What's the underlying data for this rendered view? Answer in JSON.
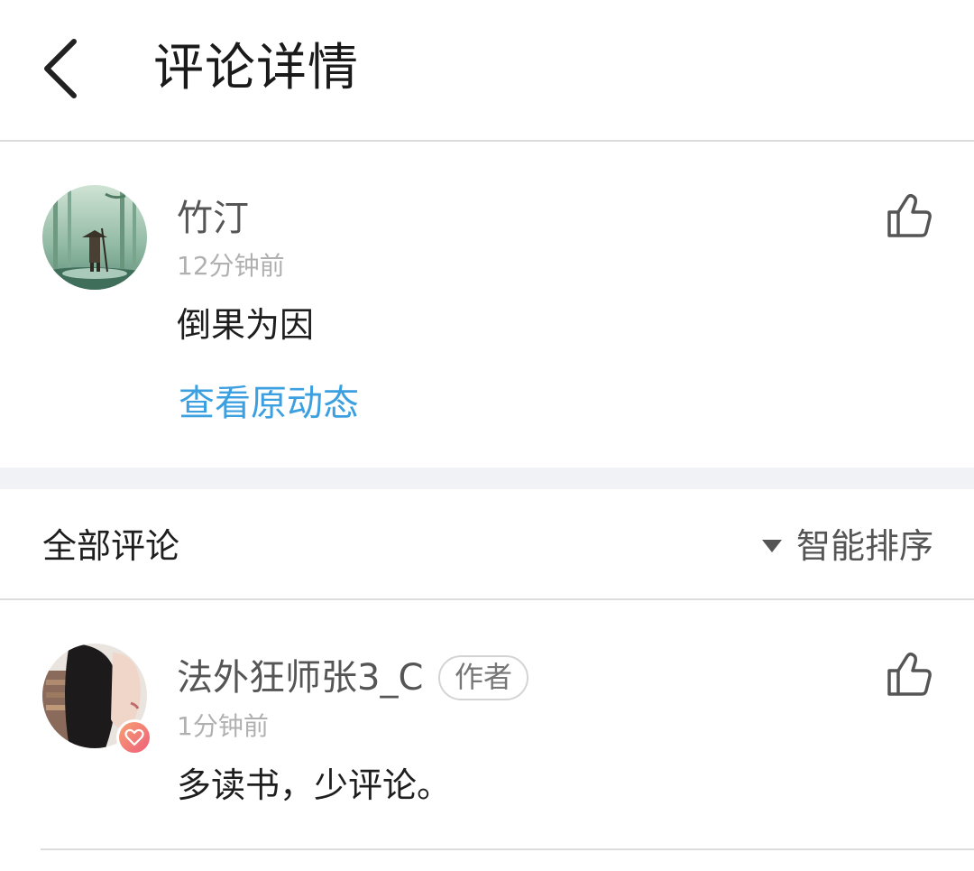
{
  "header": {
    "title": "评论详情"
  },
  "main_comment": {
    "author": "竹汀",
    "time": "12分钟前",
    "text": "倒果为因",
    "view_original": "查看原动态"
  },
  "comments_section": {
    "title": "全部评论",
    "sort_label": "智能排序"
  },
  "replies": [
    {
      "author": "法外狂师张3_C",
      "tag": "作者",
      "time": "1分钟前",
      "text": "多读书，少评论。"
    }
  ],
  "colors": {
    "link": "#3b9fe0",
    "divider": "#dcdcdc",
    "band": "#f0f2f5"
  }
}
